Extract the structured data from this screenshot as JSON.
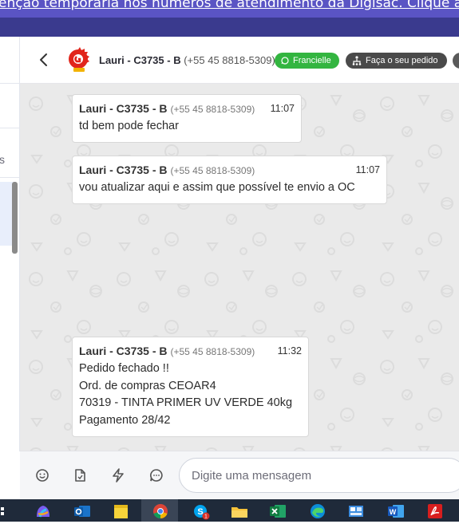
{
  "banner": {
    "text": "enção temporária nos números de atendimento da Digisac. Clique aqui"
  },
  "header": {
    "contact_name": "Lauri - C3735 - B",
    "contact_phone": "(+55 45 8818-5309)",
    "agent_badge": "Francielle",
    "order_button": "Faça o seu pedido"
  },
  "sidebar": {
    "partial_text": "s"
  },
  "messages": [
    {
      "name": "Lauri - C3735 - B",
      "phone": "(+55 45 8818-5309)",
      "time": "11:07",
      "lines": [
        "td bem pode fechar"
      ]
    },
    {
      "name": "Lauri - C3735 - B",
      "phone": "(+55 45 8818-5309)",
      "time": "11:07",
      "lines": [
        "vou atualizar aqui e assim que possível te envio a OC"
      ]
    },
    {
      "name": "Lauri - C3735 - B",
      "phone": "(+55 45 8818-5309)",
      "time": "11:32",
      "lines": [
        "Pedido fechado !!",
        "Ord. de compras CEOAR4",
        "70319 - TINTA PRIMER UV VERDE 40kg",
        "Pagamento 28/42"
      ]
    }
  ],
  "composer": {
    "placeholder": "Digite uma mensagem"
  },
  "taskbar": {
    "apps": [
      "copilot-icon",
      "outlook-icon",
      "sticky-notes-icon",
      "chrome-icon",
      "skype-icon",
      "file-explorer-icon",
      "excel-icon",
      "edge-icon",
      "control-panel-icon",
      "word-icon",
      "acrobat-icon"
    ],
    "skype_badge": "1"
  },
  "colors": {
    "accent": "#5a54c4",
    "green": "#33b540",
    "dark_pill": "#4a4a4a",
    "chat_bg": "#eaeaea"
  }
}
